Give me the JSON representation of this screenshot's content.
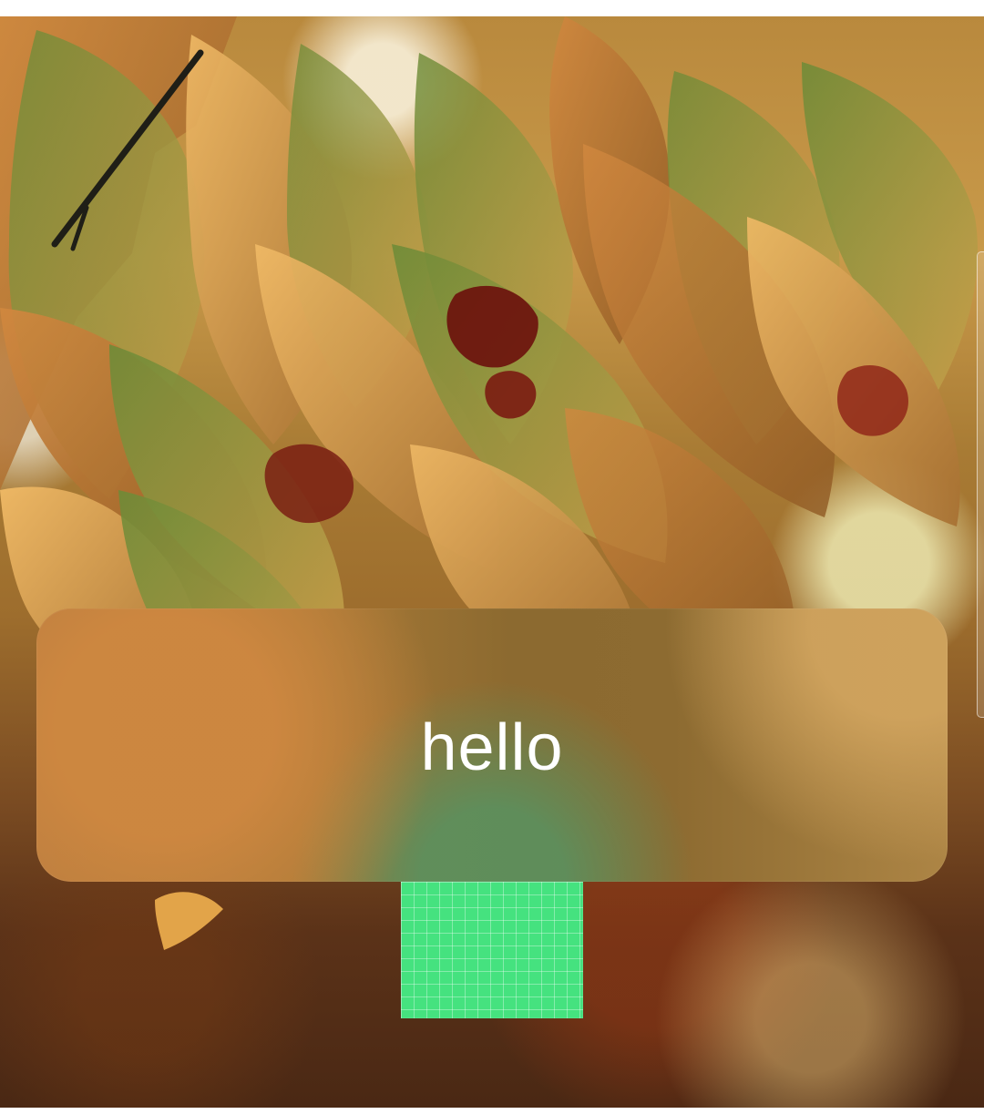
{
  "screen": {
    "background": "#ffffff"
  },
  "wallpaper": {
    "subject": "autumn leaves",
    "colors": {
      "leaf_green": "#7f8f38",
      "leaf_orange": "#d58a3e",
      "leaf_red": "#8b1c12",
      "bokeh_light": "#e8e3b0"
    }
  },
  "toast": {
    "message": "hello",
    "background_accent": "#b47a3f",
    "text_color": "#ffffff"
  },
  "grid_tile": {
    "color": "#45e27f"
  },
  "scrollbar": {
    "visible": true
  }
}
